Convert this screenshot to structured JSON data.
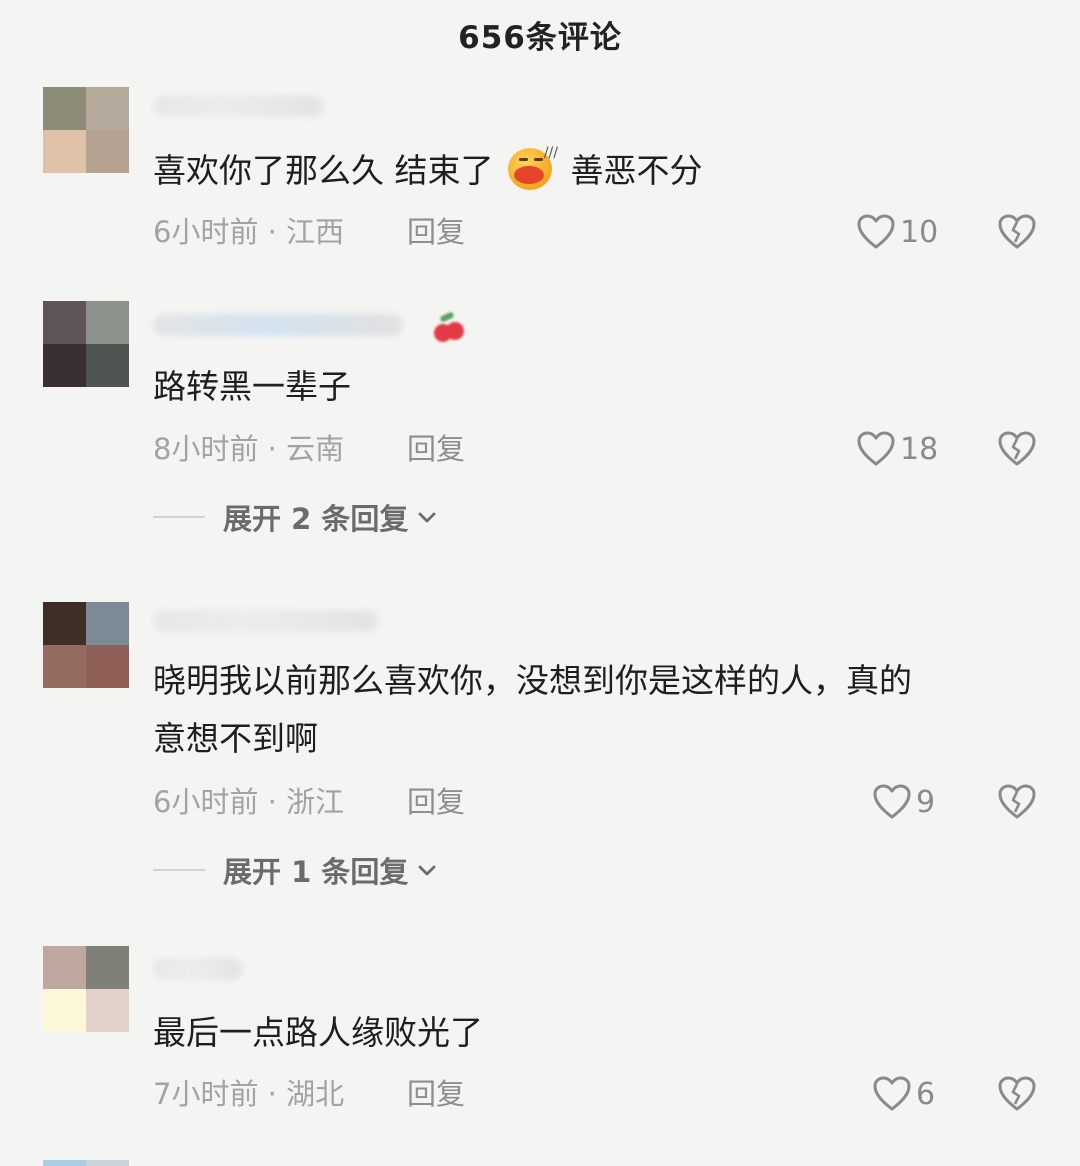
{
  "header": {
    "title": "656条评论"
  },
  "colors": {
    "background": "#f4f4f2",
    "meta": "#a3a3a3",
    "text": "#1e1e1e",
    "icon": "#8a8a8a"
  },
  "comments": [
    {
      "text_before_emoji": "喜欢你了那么久 结束了",
      "emoji": "sweating-kiss-face-emoji",
      "text_after_emoji": "善恶不分",
      "time": "6小时前",
      "location": "江西",
      "reply_label": "回复",
      "likes": "10",
      "avatar_colors": [
        "#8b8b77",
        "#b4a99a",
        "#dfc3a8",
        "#b5a293"
      ]
    },
    {
      "text": "路转黑一辈子",
      "time": "8小时前",
      "location": "云南",
      "reply_label": "回复",
      "likes": "18",
      "expand_label": "展开 2 条回复",
      "avatar_colors": [
        "#5e545a",
        "#8c918b",
        "#3a3031",
        "#4e5551"
      ]
    },
    {
      "text_line1": "晓明我以前那么喜欢你，没想到你是这样的人，真的",
      "text_line2": "意想不到啊",
      "time": "6小时前",
      "location": "浙江",
      "reply_label": "回复",
      "likes": "9",
      "expand_label": "展开 1 条回复",
      "avatar_colors": [
        "#3f2e26",
        "#7b8a94",
        "#946a61",
        "#8f5e56"
      ]
    },
    {
      "text": "最后一点路人缘败光了",
      "time": "7小时前",
      "location": "湖北",
      "reply_label": "回复",
      "likes": "6",
      "avatar_colors": [
        "#bda79f",
        "#7f8078",
        "#fbf7d8",
        "#e3d1cb"
      ]
    }
  ]
}
